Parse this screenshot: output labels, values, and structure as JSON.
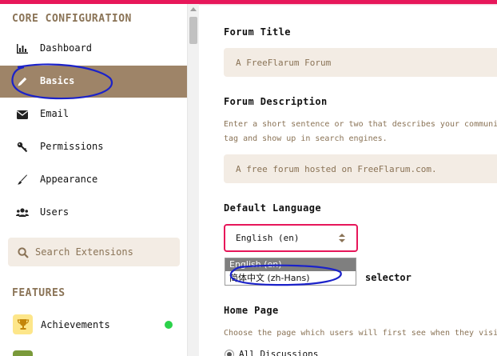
{
  "sidebar": {
    "core_title": "CORE CONFIGURATION",
    "items": [
      {
        "label": "Dashboard",
        "icon": "bar-chart-icon"
      },
      {
        "label": "Basics",
        "icon": "pencil-icon",
        "active": true
      },
      {
        "label": "Email",
        "icon": "envelope-icon"
      },
      {
        "label": "Permissions",
        "icon": "key-icon"
      },
      {
        "label": "Appearance",
        "icon": "paintbrush-icon"
      },
      {
        "label": "Users",
        "icon": "users-icon"
      }
    ],
    "search_placeholder": "Search Extensions",
    "features_title": "FEATURES",
    "extensions": [
      {
        "label": "Achievements",
        "icon": "trophy-icon",
        "enabled": true
      }
    ]
  },
  "main": {
    "forum_title": {
      "label": "Forum Title",
      "placeholder": "A FreeFlarum Forum"
    },
    "forum_description": {
      "label": "Forum Description",
      "help_line1": "Enter a short sentence or two that describes your communi",
      "help_line2": "tag and show up in search engines.",
      "placeholder": "A free forum hosted on FreeFlarum.com."
    },
    "default_language": {
      "label": "Default Language",
      "selected": "English (en)",
      "options": [
        "English (en)",
        "简体中文 (zh-Hans)"
      ],
      "trailing_text": "selector"
    },
    "home_page": {
      "label": "Home Page",
      "help": "Choose the page which users will first see when they visi",
      "radio_label": "All Discussions"
    }
  },
  "colors": {
    "accent": "#e7175a",
    "sidebar_active": "#9e8468",
    "input_bg": "#f3ece4",
    "muted_text": "#8a7356",
    "enabled_dot": "#2bd24a",
    "annotation": "#1b22c9"
  }
}
